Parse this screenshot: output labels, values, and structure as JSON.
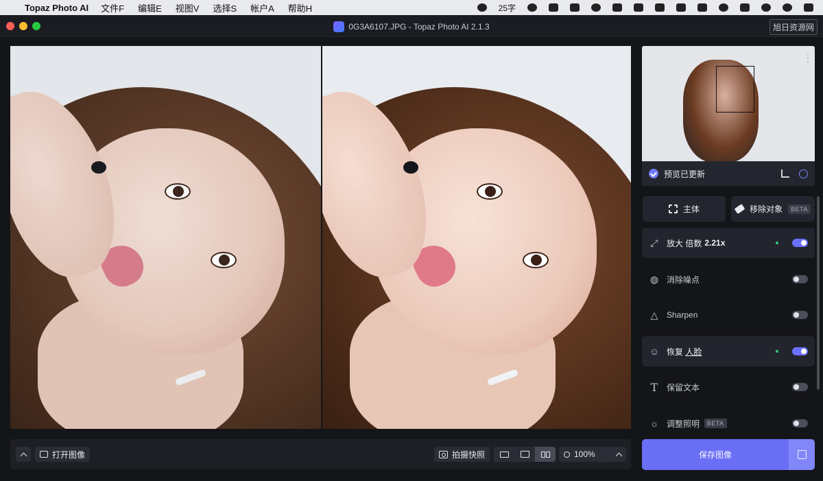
{
  "menubar": {
    "app_name": "Topaz Photo AI",
    "menus": [
      "文件F",
      "编辑E",
      "视图V",
      "选择S",
      "帐户A",
      "帮助H"
    ],
    "status_text": "25字"
  },
  "window": {
    "title": "0G3A6107.JPG - Topaz Photo AI 2.1.3",
    "watermark": "旭日资源网"
  },
  "preview": {
    "status_label": "预览已更新"
  },
  "subject_button": "主体",
  "remove_button": "移除对象",
  "remove_badge": "BETA",
  "tools": [
    {
      "label": "放大",
      "value_prefix": "倍数",
      "value": "2.21x",
      "enabled": true,
      "active": true
    },
    {
      "label": "消除噪点",
      "enabled": false,
      "active": false
    },
    {
      "label": "Sharpen",
      "enabled": false,
      "active": false
    },
    {
      "label": "恢复",
      "value": "人脸",
      "enabled": true,
      "active": true
    },
    {
      "label": "保留文本",
      "enabled": false,
      "active": false
    },
    {
      "label": "调整照明",
      "badge": "BETA",
      "enabled": false,
      "active": false
    }
  ],
  "bottombar": {
    "open_image": "打开图像",
    "snapshot": "拍摄快照",
    "zoom": "100%"
  },
  "save_button": "保存图像",
  "colors": {
    "accent": "#6a6ef5",
    "toggle_on": "#6a71ff",
    "background": "#141518",
    "panel": "#23262e"
  }
}
